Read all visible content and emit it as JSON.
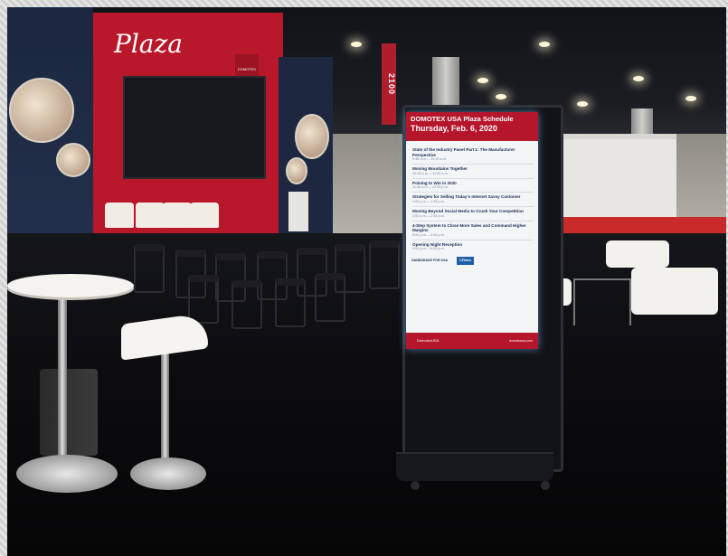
{
  "stage": {
    "title": "Plaza",
    "brand_tag": "DOMOTEX",
    "hall_banner": "2100"
  },
  "kiosk": {
    "header_title": "DOMOTEX USA Plaza Schedule",
    "header_date": "Thursday, Feb. 6, 2020",
    "sessions": [
      {
        "title": "State of the Industry Panel Part 1: The Manufacturer Perspective",
        "time": "9:45 a.m. – 10:30 a.m."
      },
      {
        "title": "Moving Mountains Together",
        "time": "10:45 a.m. – 11:30 a.m."
      },
      {
        "title": "Poising to Win in 2020",
        "time": "11:45 a.m. – 12:30 p.m."
      },
      {
        "title": "Strategies for Selling Today's Internet Savvy Customer",
        "time": "1:00 p.m. – 1:45 p.m."
      },
      {
        "title": "Moving Beyond Social Media to Crush Your Competition",
        "time": "2:00 p.m. – 2:45 p.m."
      },
      {
        "title": "4-Step System to Close More Sales and Command Higher Margins",
        "time": "3:00 p.m. – 3:45 p.m."
      },
      {
        "title": "Opening Night Reception",
        "time": "4:00 p.m. – 6:00 p.m."
      }
    ],
    "sponsor_1": "HANDSHAKE FOR USA",
    "sponsor_2": "CFIntec",
    "footer_logo": "DomotexUSA",
    "footer_right": "domotexusa.com"
  }
}
